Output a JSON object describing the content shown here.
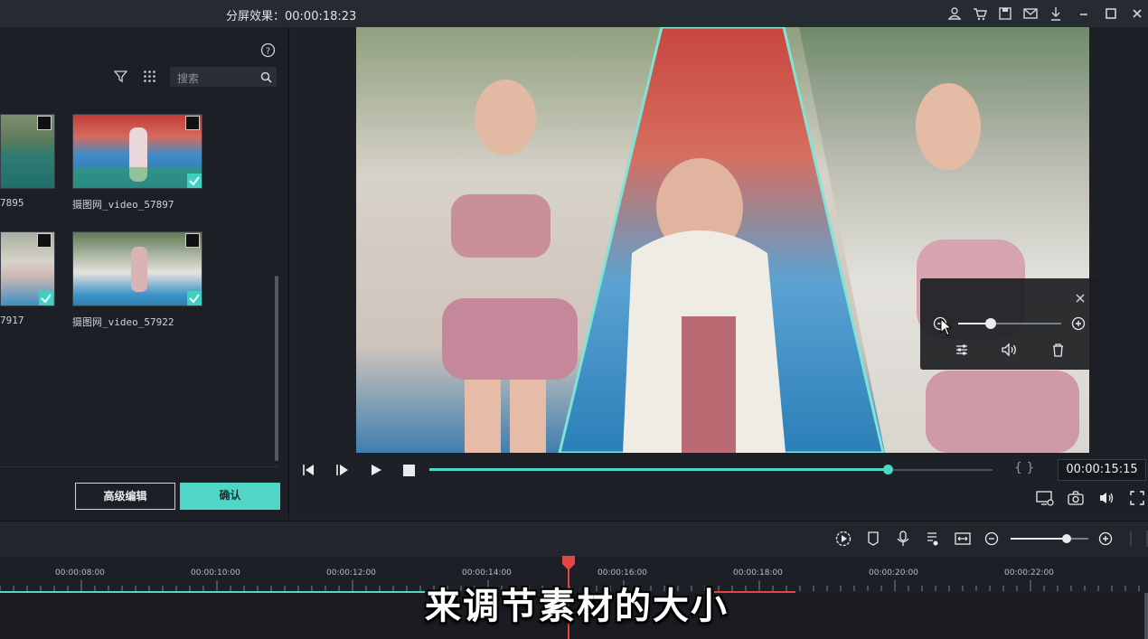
{
  "titlebar": {
    "title": "分屏效果：00:00:18:23",
    "icons": [
      "user-icon",
      "cart-icon",
      "save-icon",
      "mail-icon",
      "download-icon",
      "minimize-icon",
      "maximize-icon",
      "close-icon"
    ]
  },
  "media_panel": {
    "search_placeholder": "搜索",
    "clips": [
      {
        "name": "7895",
        "checked": false
      },
      {
        "name": "摄图网_video_57897",
        "checked": true
      },
      {
        "name": "7917",
        "checked": true
      },
      {
        "name": "摄图网_video_57922",
        "checked": true
      }
    ],
    "advanced_edit_label": "高级编辑",
    "confirm_label": "确认"
  },
  "player": {
    "timecode": "00:00:15:15",
    "progress": 0.814,
    "brackets": "{ }"
  },
  "volume_popup": {
    "level": 0.32
  },
  "timeline": {
    "ticks": [
      "00:00:08:00",
      "00:00:10:00",
      "00:00:12:00",
      "00:00:14:00",
      "00:00:16:00",
      "00:00:18:00",
      "00:00:20:00",
      "00:00:22:00"
    ],
    "zoom_level": 0.72
  },
  "subtitle": "来调节素材的大小",
  "colors": {
    "accent": "#4fd6c6",
    "playhead": "#e64444"
  }
}
